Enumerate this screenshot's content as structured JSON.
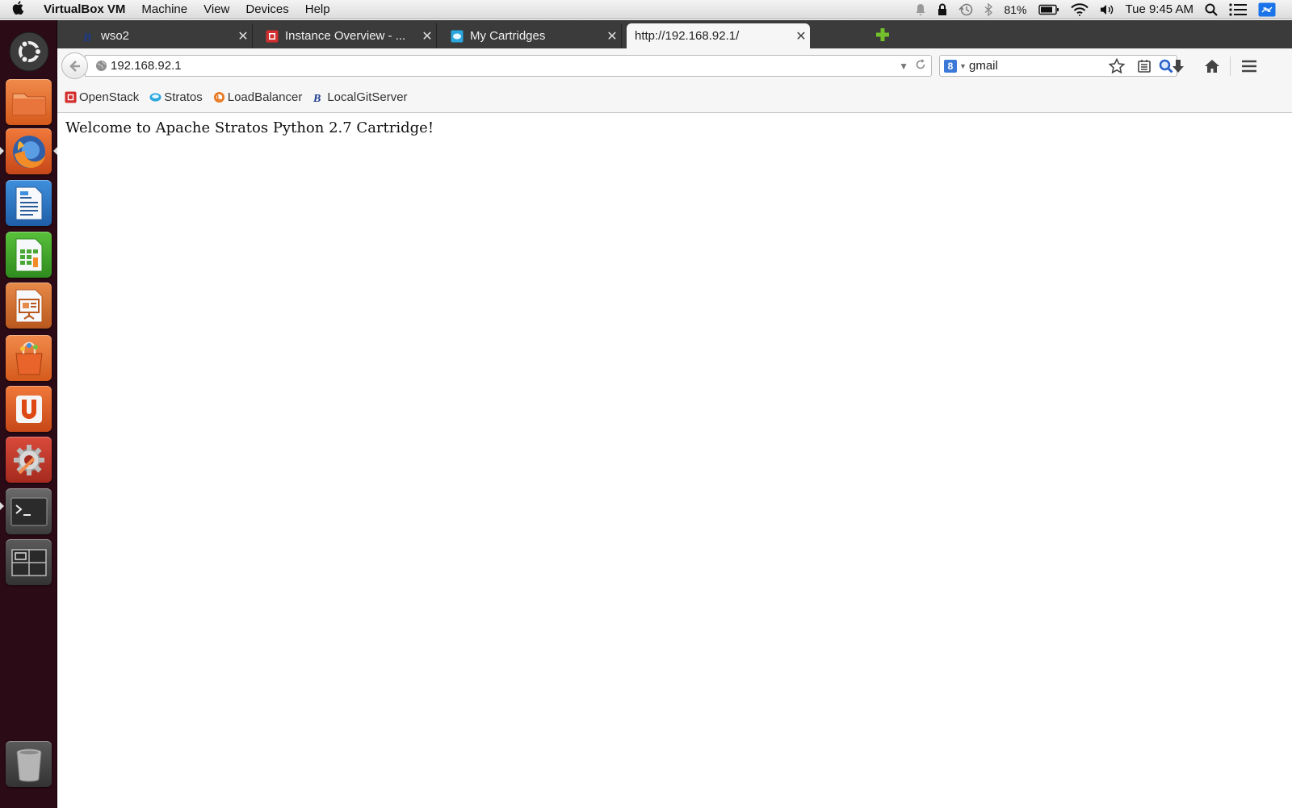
{
  "menubar": {
    "app_name": "VirtualBox VM",
    "items": [
      "Machine",
      "View",
      "Devices",
      "Help"
    ],
    "battery": "81%",
    "clock": "Tue 9:45 AM"
  },
  "launcher": {
    "icons": [
      "ubuntu-dash-icon",
      "files-icon",
      "firefox-icon",
      "writer-icon",
      "calc-icon",
      "impress-icon",
      "software-center-icon",
      "ubuntu-one-icon",
      "system-settings-icon",
      "terminal-icon",
      "workspace-switcher-icon",
      "trash-icon"
    ]
  },
  "tabs": [
    {
      "label": "wso2",
      "icon": "wso2-b-icon"
    },
    {
      "label": "Instance Overview - ...",
      "icon": "openstack-icon"
    },
    {
      "label": "My Cartridges",
      "icon": "stratos-icon"
    },
    {
      "label": "http://192.168.92.1/",
      "icon": "",
      "active": true
    }
  ],
  "navbar": {
    "url": "192.168.92.1",
    "search_value": "gmail",
    "search_engine": "google-icon"
  },
  "bookmarks": [
    {
      "label": "OpenStack",
      "icon": "openstack-icon"
    },
    {
      "label": "Stratos",
      "icon": "stratos-icon"
    },
    {
      "label": "LoadBalancer",
      "icon": "loadbalancer-icon"
    },
    {
      "label": "LocalGitServer",
      "icon": "wso2-b-icon"
    }
  ],
  "page": {
    "text": "Welcome to Apache Stratos Python 2.7 Cartridge!"
  },
  "colors": {
    "launcher_bg": "#2b0b16",
    "tabstrip_bg": "#3b3b3b",
    "new_tab": "#73c02a"
  }
}
